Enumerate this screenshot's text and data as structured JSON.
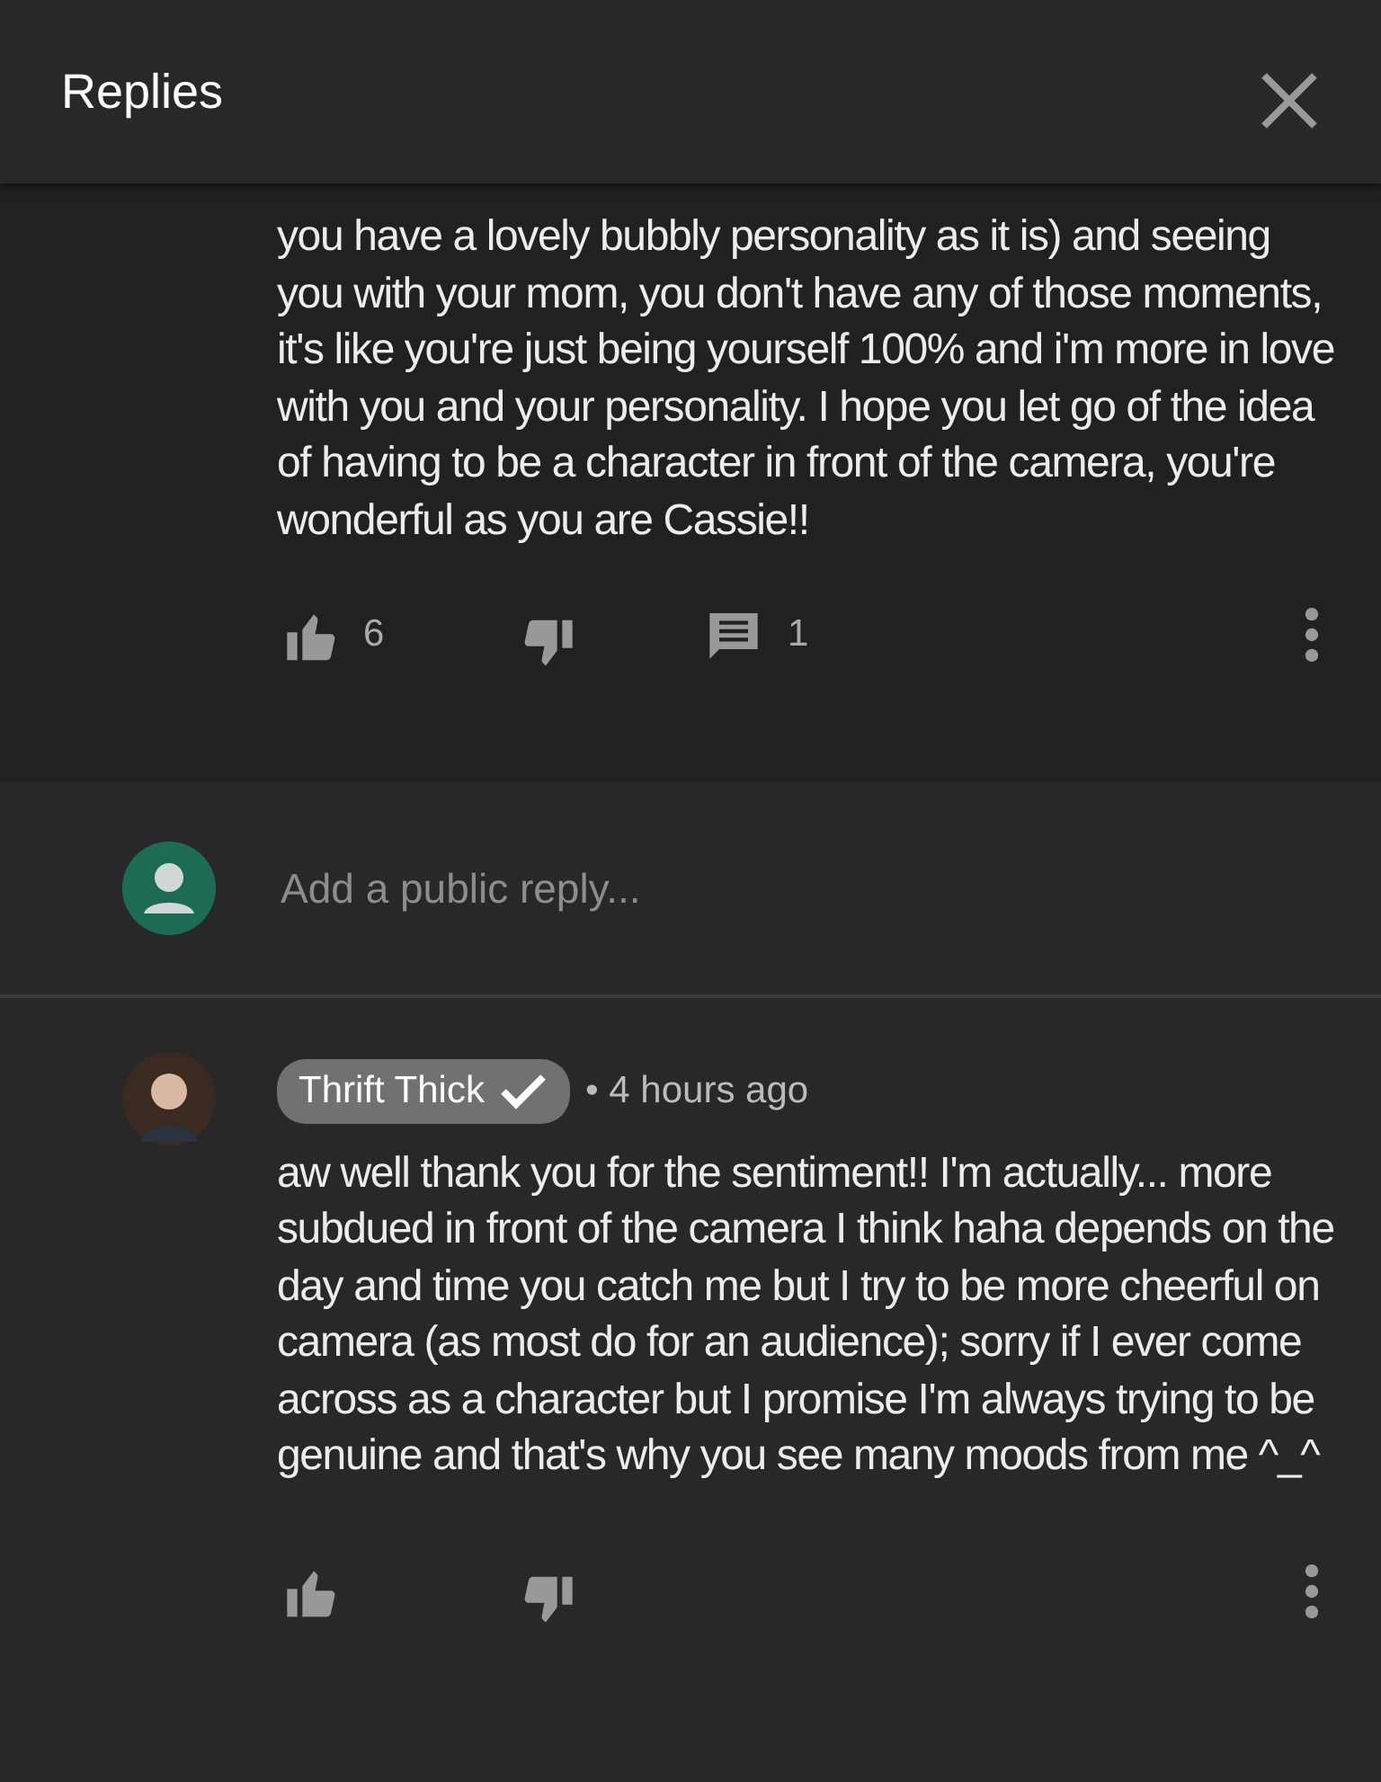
{
  "header": {
    "title": "Replies"
  },
  "parent_comment": {
    "text": "you have a lovely bubbly personality as it is) and seeing you with your mom, you don't have any of those moments, it's like you're just being yourself 100% and i'm more in love with you and your personality. I hope you let go of the idea of having to be a character in front of the camera, you're wonderful as you are Cassie!!",
    "likes": "6",
    "replies": "1"
  },
  "reply_box": {
    "placeholder": "Add a public reply..."
  },
  "replies": [
    {
      "author": "Thrift Thick",
      "verified": true,
      "time": "• 4 hours ago",
      "text": "aw well thank you for the sentiment!! I'm actually... more subdued in front of the camera I think haha depends on the day and time you catch me but I try to be more cheerful on camera (as most do for an audience); sorry if I ever come across as a character but I promise I'm always trying to be genuine and that's why you see many moods from me ^_^"
    }
  ]
}
